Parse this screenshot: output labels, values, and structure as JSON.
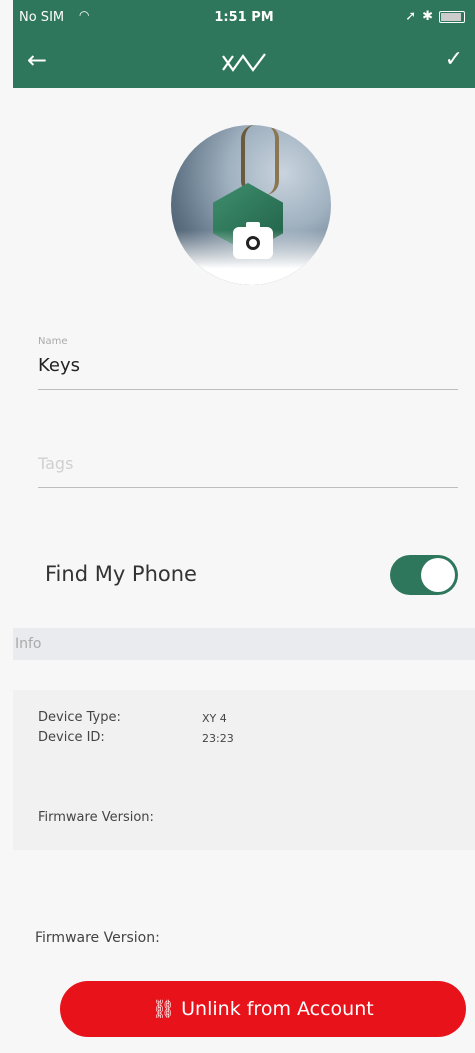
{
  "status_bar": {
    "carrier": "No SIM",
    "wifi_icon": "wifi-icon",
    "time": "1:51 PM"
  },
  "nav": {
    "back_icon": "arrow-left-icon",
    "logo": "XY",
    "confirm_icon": "checkmark-icon"
  },
  "profile": {
    "photo_alt": "keys-photo",
    "camera_icon": "camera-icon"
  },
  "name_field": {
    "label": "Name",
    "value": "Keys"
  },
  "tags_field": {
    "placeholder": "Tags"
  },
  "find_my_phone": {
    "label": "Find My Phone",
    "enabled": true
  },
  "info_section": {
    "title": "Info",
    "rows": [
      {
        "key": "Device Type:",
        "value": "XY 4"
      },
      {
        "key": "Device ID:",
        "value": "23:23"
      }
    ],
    "firmware_label": "Firmware Version:"
  },
  "footer": {
    "firmware_label": "Firmware Version:",
    "unlink_label": "Unlink from Account"
  },
  "colors": {
    "brand_green": "#2e775d",
    "danger_red": "#e8121b"
  }
}
